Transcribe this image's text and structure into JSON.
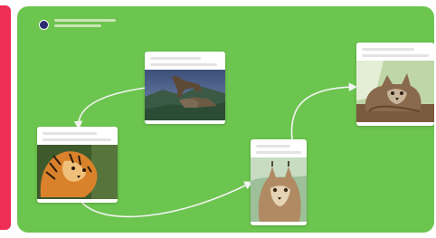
{
  "colors": {
    "accent": "#ee2f55",
    "canvas_background": "#6cc54e",
    "card_background": "#ffffff",
    "connector": "#f4f4f4",
    "avatar": "#2b2b6e"
  },
  "header": {
    "icon": "user-avatar-icon"
  },
  "cards": [
    {
      "name": "card-wolves",
      "icon": "wolves-photo"
    },
    {
      "name": "card-tiger",
      "icon": "tiger-photo"
    },
    {
      "name": "card-lynx",
      "icon": "lynx-photo"
    },
    {
      "name": "card-maine-coon",
      "icon": "maine-coon-cat-photo"
    }
  ],
  "connectors": [
    {
      "name": "connector-wolves-to-tiger",
      "icon": "arrow-icon"
    },
    {
      "name": "connector-tiger-to-lynx",
      "icon": "arrow-icon"
    },
    {
      "name": "connector-lynx-to-cat",
      "icon": "arrow-icon"
    }
  ]
}
